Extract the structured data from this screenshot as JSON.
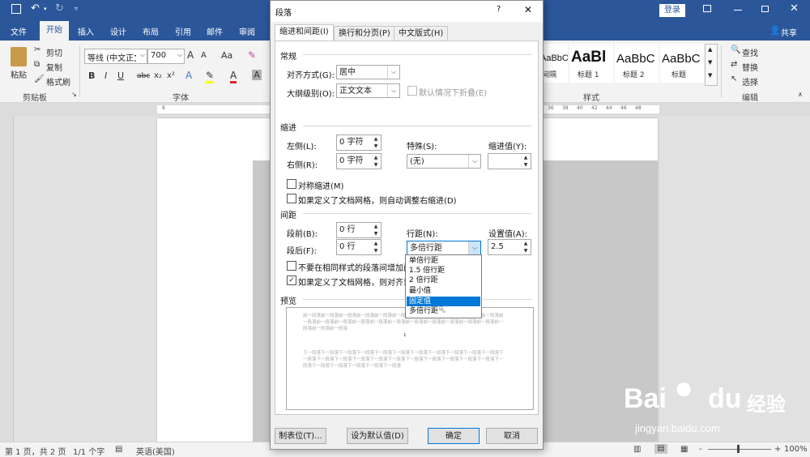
{
  "word": {
    "titlebar": {
      "login": "登录",
      "share": "共享"
    },
    "ribbon_tabs": [
      "文件",
      "开始",
      "插入",
      "设计",
      "布局",
      "引用",
      "邮件",
      "审阅"
    ],
    "active_tab": "开始",
    "clipboard": {
      "paste": "粘贴",
      "cut": "剪切",
      "copy": "复制",
      "format_painter": "格式刷",
      "group": "剪贴板"
    },
    "font": {
      "name": "等线 (中文正文)",
      "size": "700",
      "grow": "A",
      "shrink": "A",
      "change_case": "Aa",
      "bold": "B",
      "italic": "I",
      "underline": "U",
      "strike": "abc",
      "subscript": "x₂",
      "superscript": "x²",
      "group": "字体"
    },
    "styles": {
      "items": [
        {
          "preview": "AaBbCcDc",
          "name": "间隔"
        },
        {
          "preview": "AaBl",
          "name": "标题 1"
        },
        {
          "preview": "AaBbC",
          "name": "标题 2"
        },
        {
          "preview": "AaBbC",
          "name": "标题"
        }
      ],
      "group": "样式"
    },
    "editing": {
      "find": "查找",
      "replace": "替换",
      "select": "选择",
      "group": "编辑"
    },
    "ruler_left": "8",
    "ruler_right": [
      "36",
      "38",
      "40",
      "42",
      "44",
      "46",
      "48"
    ],
    "status": {
      "page": "第 1 页，共 2 页",
      "words": "1/1 个字",
      "lang": "英语(美国)",
      "zoom": "100%",
      "zoom_minus": "-",
      "zoom_plus": "+"
    }
  },
  "dialog": {
    "title": "段落",
    "help": "?",
    "close": "✕",
    "tabs": [
      "缩进和间距(I)",
      "换行和分页(P)",
      "中文版式(H)"
    ],
    "general": {
      "heading": "常规",
      "align_label": "对齐方式(G):",
      "align_value": "居中",
      "outline_label": "大纲级别(O):",
      "outline_value": "正文文本",
      "collapse_label": "默认情况下折叠(E)"
    },
    "indent": {
      "heading": "缩进",
      "left_label": "左侧(L):",
      "left_value": "0 字符",
      "right_label": "右侧(R):",
      "right_value": "0 字符",
      "special_label": "特殊(S):",
      "special_value": "(无)",
      "by_label": "缩进值(Y):",
      "by_value": "",
      "mirror_label": "对称缩进(M)",
      "auto_adjust_label": "如果定义了文档网格，则自动调整右缩进(D)"
    },
    "spacing": {
      "heading": "间距",
      "before_label": "段前(B):",
      "before_value": "0 行",
      "after_label": "段后(F):",
      "after_value": "0 行",
      "line_label": "行距(N):",
      "line_value": "多倍行距",
      "at_label": "设置值(A):",
      "at_value": "2.5",
      "no_space_label": "不要在相同样式的段落间增加间距",
      "snap_grid_label": "如果定义了文档网格，则对齐到网格"
    },
    "line_spacing_options": [
      "单倍行距",
      "1.5 倍行距",
      "2 倍行距",
      "最小值",
      "固定值",
      "多倍行距"
    ],
    "highlighted_option": "固定值",
    "preview": {
      "heading": "预览",
      "prev_text": "前一段落前一段落前一段落前一段落前一段落前一段落前一段落前一段落前一段落前一段落前一段落前一段落前一段落前一段落前一段落前一段落前一段落前一段落前一段落前一段落前一段落前一段落前一段落前一段落前一段落",
      "current_text": "1",
      "next_text": "下一段落下一段落下一段落下一段落下一段落下一段落下一段落下一段落下一段落下一段落下一段落下一段落下一段落下一段落下一段落下一段落下一段落下一段落下一段落下一段落下一段落下一段落下一段落下一段落下一段落下一段落下一段落下一段落"
    },
    "buttons": {
      "tabs": "制表位(T)...",
      "default": "设为默认值(D)",
      "ok": "确定",
      "cancel": "取消"
    }
  },
  "watermark": {
    "brand": "Bai",
    "brand2": "du",
    "cn": "经验",
    "url": "jingyan.baidu.com"
  },
  "colors": {
    "word_blue": "#2b579a",
    "accent": "#0078d7"
  }
}
